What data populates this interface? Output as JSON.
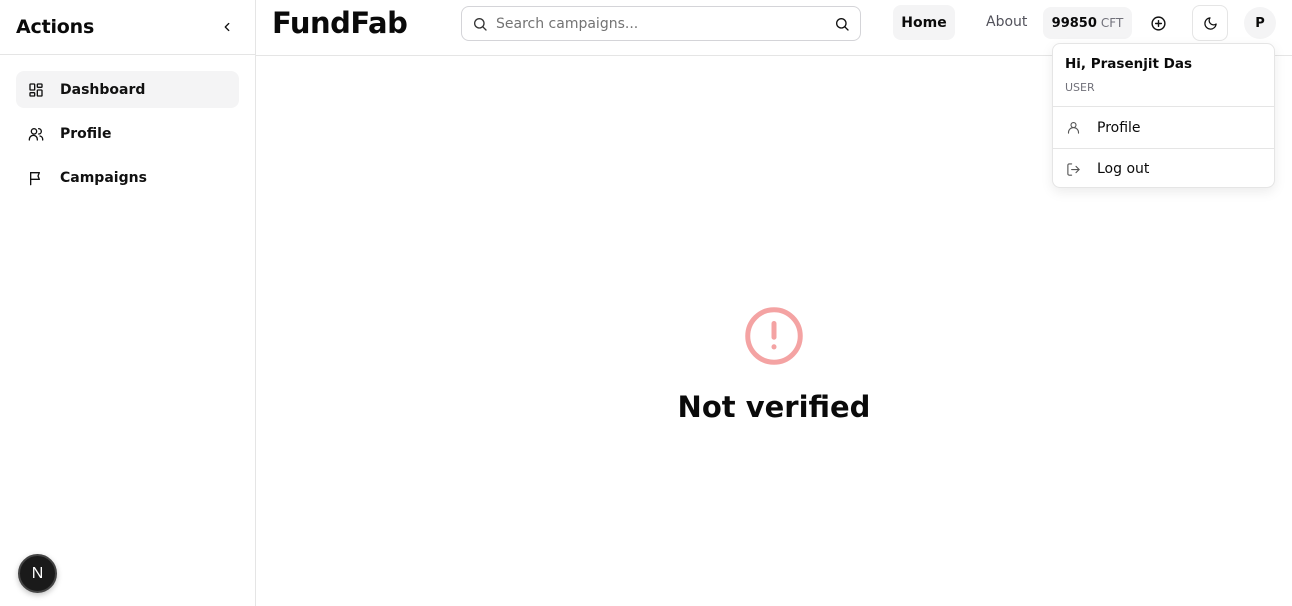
{
  "sidebar": {
    "title": "Actions",
    "items": [
      {
        "label": "Dashboard",
        "icon": "dashboard-icon"
      },
      {
        "label": "Profile",
        "icon": "users-icon"
      },
      {
        "label": "Campaigns",
        "icon": "flag-icon"
      }
    ],
    "badge": "N"
  },
  "header": {
    "brand": "FundFab",
    "search_placeholder": "Search campaigns...",
    "home_label": "Home",
    "about_label": "About",
    "balance_amount": "99850",
    "balance_unit": "CFT",
    "avatar_initial": "P"
  },
  "main": {
    "status_title": "Not verified"
  },
  "dropdown": {
    "greeting": "Hi, Prasenjit Das",
    "role": "USER",
    "items": [
      {
        "label": "Profile",
        "icon": "user-icon"
      },
      {
        "label": "Log out",
        "icon": "logout-icon"
      }
    ]
  },
  "colors": {
    "alert": "#f4a3a3",
    "active_bg": "#f4f4f5",
    "border": "#e5e5e5"
  }
}
